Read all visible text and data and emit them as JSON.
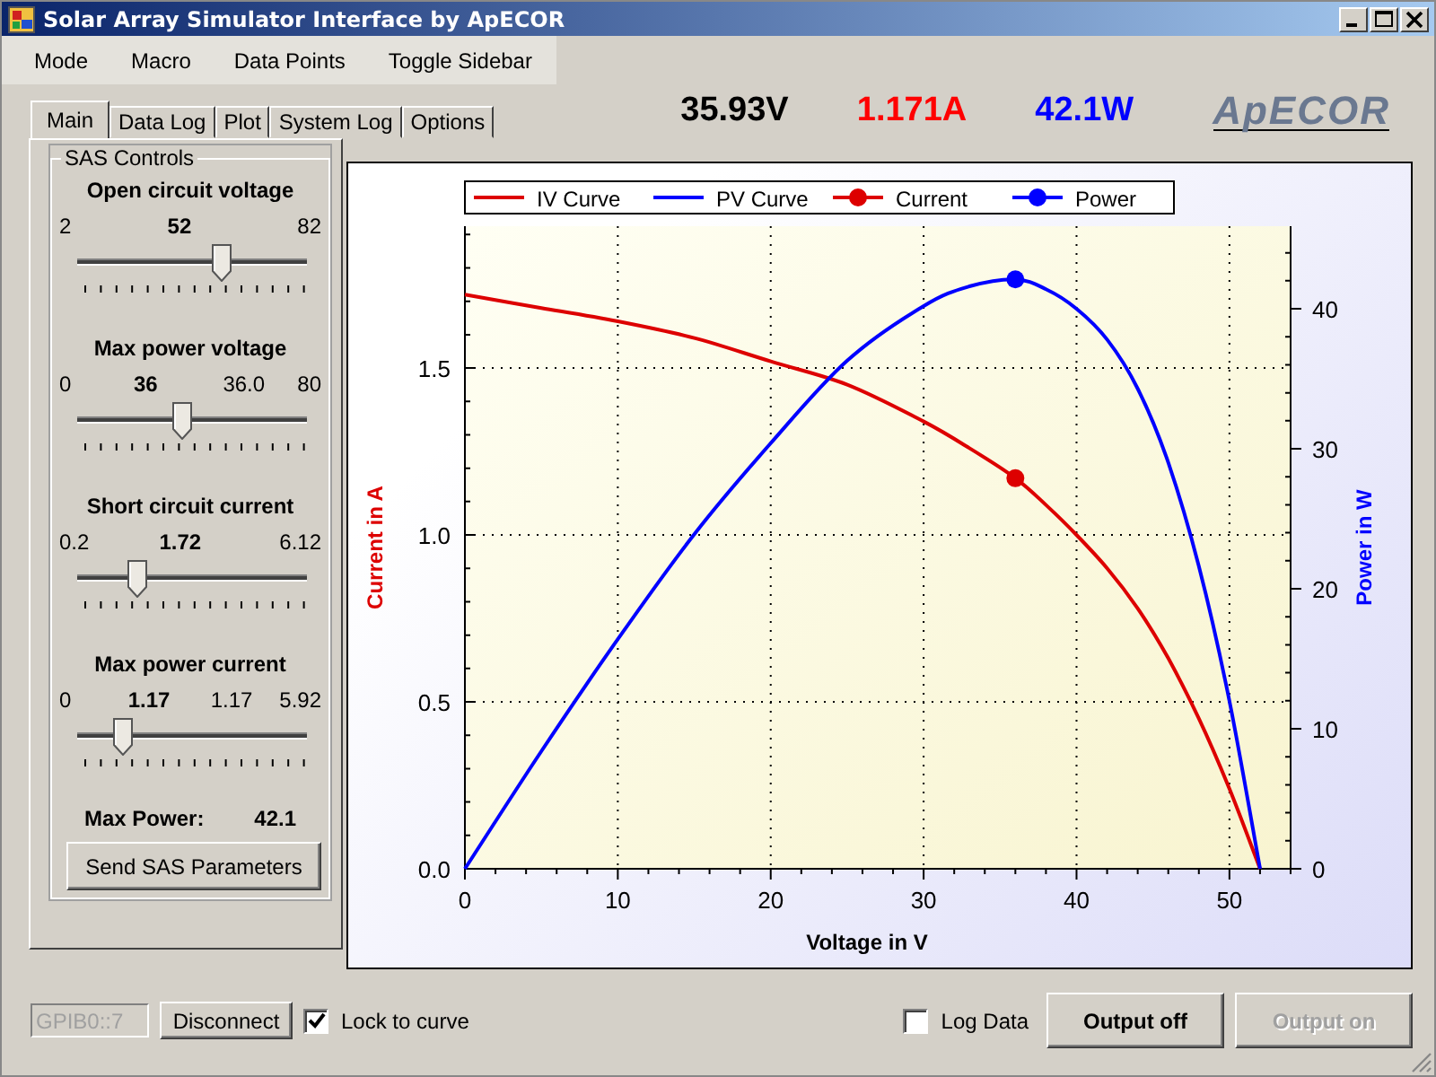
{
  "window": {
    "title": "Solar Array Simulator Interface by ApECOR"
  },
  "menu": [
    "Mode",
    "Macro",
    "Data Points",
    "Toggle Sidebar"
  ],
  "tabs": [
    {
      "label": "Main",
      "selected": true
    },
    {
      "label": "Data Log",
      "selected": false
    },
    {
      "label": "Plot",
      "selected": false
    },
    {
      "label": "System Log",
      "selected": false
    },
    {
      "label": "Options",
      "selected": false
    }
  ],
  "readouts": [
    {
      "text": "35.93V",
      "color": "#000000"
    },
    {
      "text": "1.171A",
      "color": "#ff0000"
    },
    {
      "text": "42.1W",
      "color": "#0000ff"
    }
  ],
  "logo": "ApECOR",
  "sas_controls": {
    "title": "SAS Controls",
    "sliders": [
      {
        "label": "Open circuit voltage",
        "min": "2",
        "value": "52",
        "max": "82",
        "level": 0.625
      },
      {
        "label": "Max power voltage",
        "min": "0",
        "value": "36",
        "setpoint": "36.0",
        "max": "80",
        "level": 0.45
      },
      {
        "label": "Short circuit current",
        "min": "0.2",
        "value": "1.72",
        "max": "6.12",
        "level": 0.257
      },
      {
        "label": "Max power current",
        "min": "0",
        "value": "1.17",
        "setpoint": "1.17",
        "max": "5.92",
        "level": 0.198
      }
    ],
    "max_power": {
      "label": "Max Power:",
      "value": "42.1"
    },
    "send_button": "Send SAS Parameters"
  },
  "chart": {
    "chart_data": {
      "type": "line",
      "xlabel": "Voltage in V",
      "ylabel": "Current in A",
      "y2label": "Power in W",
      "x": [
        0,
        5,
        10,
        15,
        20,
        25,
        30,
        33,
        36,
        38,
        40,
        42,
        44,
        46,
        48,
        50,
        52
      ],
      "series": [
        {
          "name": "IV Curve",
          "color": "#dd0000",
          "values": [
            1.72,
            1.68,
            1.64,
            1.59,
            1.52,
            1.45,
            1.34,
            1.26,
            1.17,
            1.09,
            1.0,
            0.9,
            0.78,
            0.63,
            0.45,
            0.24,
            0.0
          ]
        },
        {
          "name": "PV Curve",
          "color": "#0000ff",
          "axis": "y2",
          "values": [
            0,
            8.4,
            16.4,
            23.9,
            30.4,
            36.3,
            40.2,
            41.6,
            42.1,
            41.4,
            40,
            37.8,
            34.3,
            29.0,
            21.6,
            12,
            0
          ]
        },
        {
          "name": "Current",
          "color": "#dd0000",
          "type": "scatter",
          "values": [
            null,
            null,
            null,
            null,
            null,
            null,
            null,
            null,
            1.17,
            null,
            null,
            null,
            null,
            null,
            null,
            null,
            null
          ]
        },
        {
          "name": "Power",
          "color": "#0000ff",
          "type": "scatter",
          "axis": "y2",
          "values": [
            null,
            null,
            null,
            null,
            null,
            null,
            null,
            null,
            42.1,
            null,
            null,
            null,
            null,
            null,
            null,
            null,
            null
          ]
        }
      ],
      "grid": true,
      "legend": true,
      "xlim": [
        0,
        54
      ],
      "ylim": [
        0,
        1.925
      ],
      "y2lim": [
        0,
        45.9
      ],
      "xticks": [
        0,
        10,
        20,
        30,
        40,
        50
      ],
      "yticks": [
        {
          "value": 0,
          "label": "0.0"
        },
        {
          "value": 0.5,
          "label": "0.5"
        },
        {
          "value": 1,
          "label": "1.0"
        },
        {
          "value": 1.5,
          "label": "1.5"
        }
      ],
      "y2ticks": [
        0,
        10,
        20,
        30,
        40
      ]
    }
  },
  "bottom_bar": {
    "address": {
      "value": "GPIB0::7",
      "disabled": true
    },
    "disconnect_button": "Disconnect",
    "lock_to_curve": {
      "label": "Lock to curve",
      "checked": true
    },
    "log_data": {
      "label": "Log Data",
      "checked": false
    },
    "buttons": [
      {
        "label": "Output off",
        "disabled": false
      },
      {
        "label": "Output on",
        "disabled": true
      }
    ]
  }
}
